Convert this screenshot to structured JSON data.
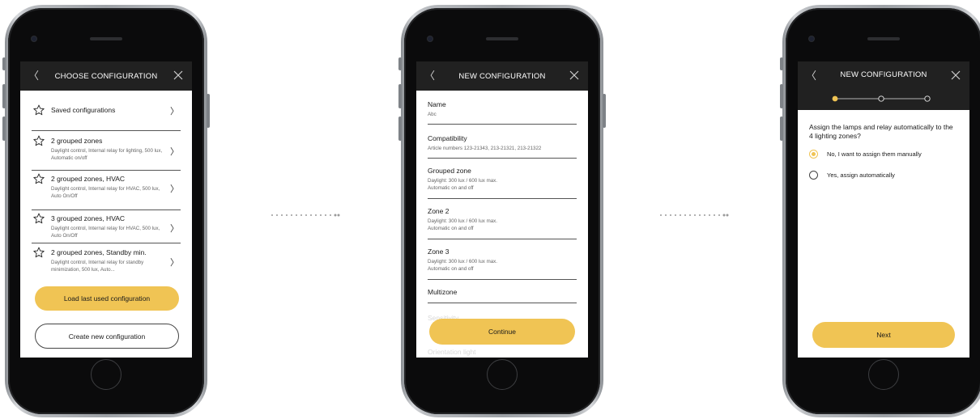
{
  "screen1": {
    "title": "CHOOSE CONFIGURATION",
    "items": [
      {
        "title": "Saved configurations",
        "desc": ""
      },
      {
        "title": "2 grouped zones",
        "desc": "Daylight control, Internal relay for lighting, 500 lux, Automatic on/off"
      },
      {
        "title": "2 grouped zones, HVAC",
        "desc": "Daylight control, Internal relay for HVAC, 500 lux, Auto On/Off"
      },
      {
        "title": "3 grouped zones, HVAC",
        "desc": "Daylight control, Internal relay for HVAC, 500 lux, Auto On/Off"
      },
      {
        "title": "2 grouped zones, Standby min.",
        "desc": "Daylight control, Internal relay for standby minimization, 500 lux, Auto..."
      }
    ],
    "primary_button": "Load last used configuration",
    "secondary_button": "Create new configuration"
  },
  "screen2": {
    "title": "NEW CONFIGURATION",
    "fields": [
      {
        "label": "Name",
        "value": "Abc"
      },
      {
        "label": "Compatibility",
        "value": "Article numbers 123-21343, 213-21321, 213-21322"
      },
      {
        "label": "Grouped zone",
        "value": "Daylight: 300 lux / 600 lux max.\nAutomatic on and off"
      },
      {
        "label": "Zone 2",
        "value": "Daylight: 300 lux / 600 lux max.\nAutomatic on and off"
      },
      {
        "label": "Zone 3",
        "value": "Daylight: 300 lux / 600 lux max.\nAutomatic on and off"
      },
      {
        "label": "Multizone",
        "value": ""
      }
    ],
    "faded_items": [
      "Sensitivity",
      "Orientation light"
    ],
    "button": "Continue"
  },
  "screen3": {
    "title": "NEW CONFIGURATION",
    "question": "Assign the lamps and relay automatically to the 4 lighting zones?",
    "options": [
      {
        "label": "No, I want to assign them manually",
        "selected": true
      },
      {
        "label": "Yes, assign automatically",
        "selected": false
      }
    ],
    "steps_total": 3,
    "step_current": 1,
    "button": "Next"
  },
  "colors": {
    "accent": "#f0c454",
    "header": "#212121",
    "divider": "#555555"
  },
  "icons": [
    "back-chevron-icon",
    "close-icon",
    "star-icon",
    "chevron-right-icon",
    "home-button-icon"
  ]
}
